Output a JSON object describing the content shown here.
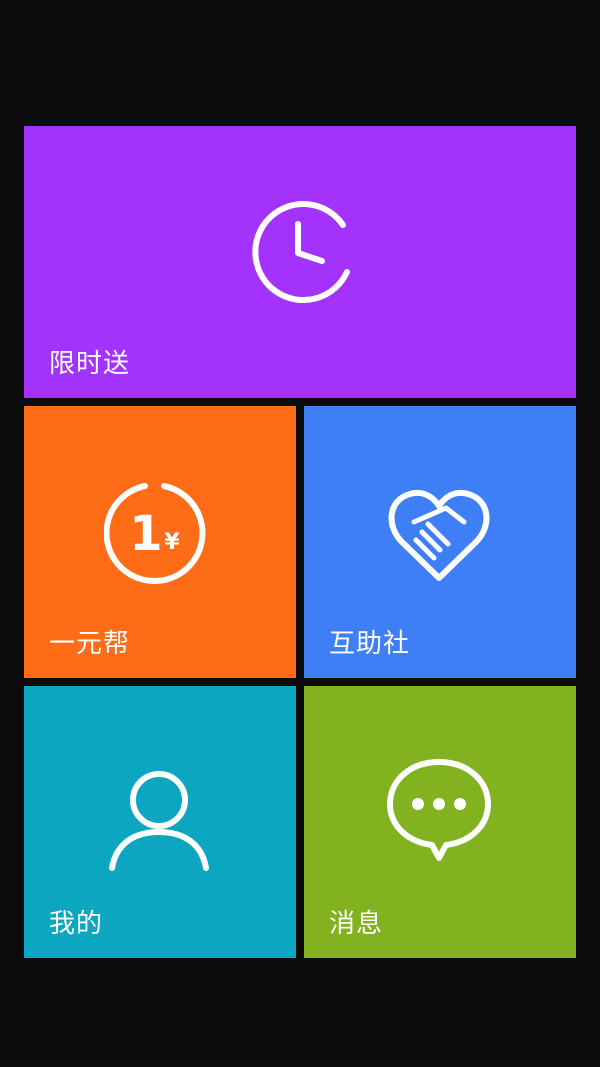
{
  "colors": {
    "background": "#0b0b0b",
    "tile_limited_delivery": "#a332fb",
    "tile_one_yuan_help": "#fe6c17",
    "tile_mutual_aid": "#3e7ff5",
    "tile_mine": "#0ca6c0",
    "tile_messages": "#83b220",
    "icon_stroke": "#ffffff"
  },
  "tiles": {
    "limited_delivery": {
      "label": "限时送",
      "icon": "clock-icon"
    },
    "one_yuan_help": {
      "label": "一元帮",
      "icon": "one-yuan-coin-icon",
      "icon_text": "1",
      "icon_currency": "¥"
    },
    "mutual_aid": {
      "label": "互助社",
      "icon": "handshake-heart-icon"
    },
    "mine": {
      "label": "我的",
      "icon": "user-icon"
    },
    "messages": {
      "label": "消息",
      "icon": "chat-bubble-icon"
    }
  }
}
